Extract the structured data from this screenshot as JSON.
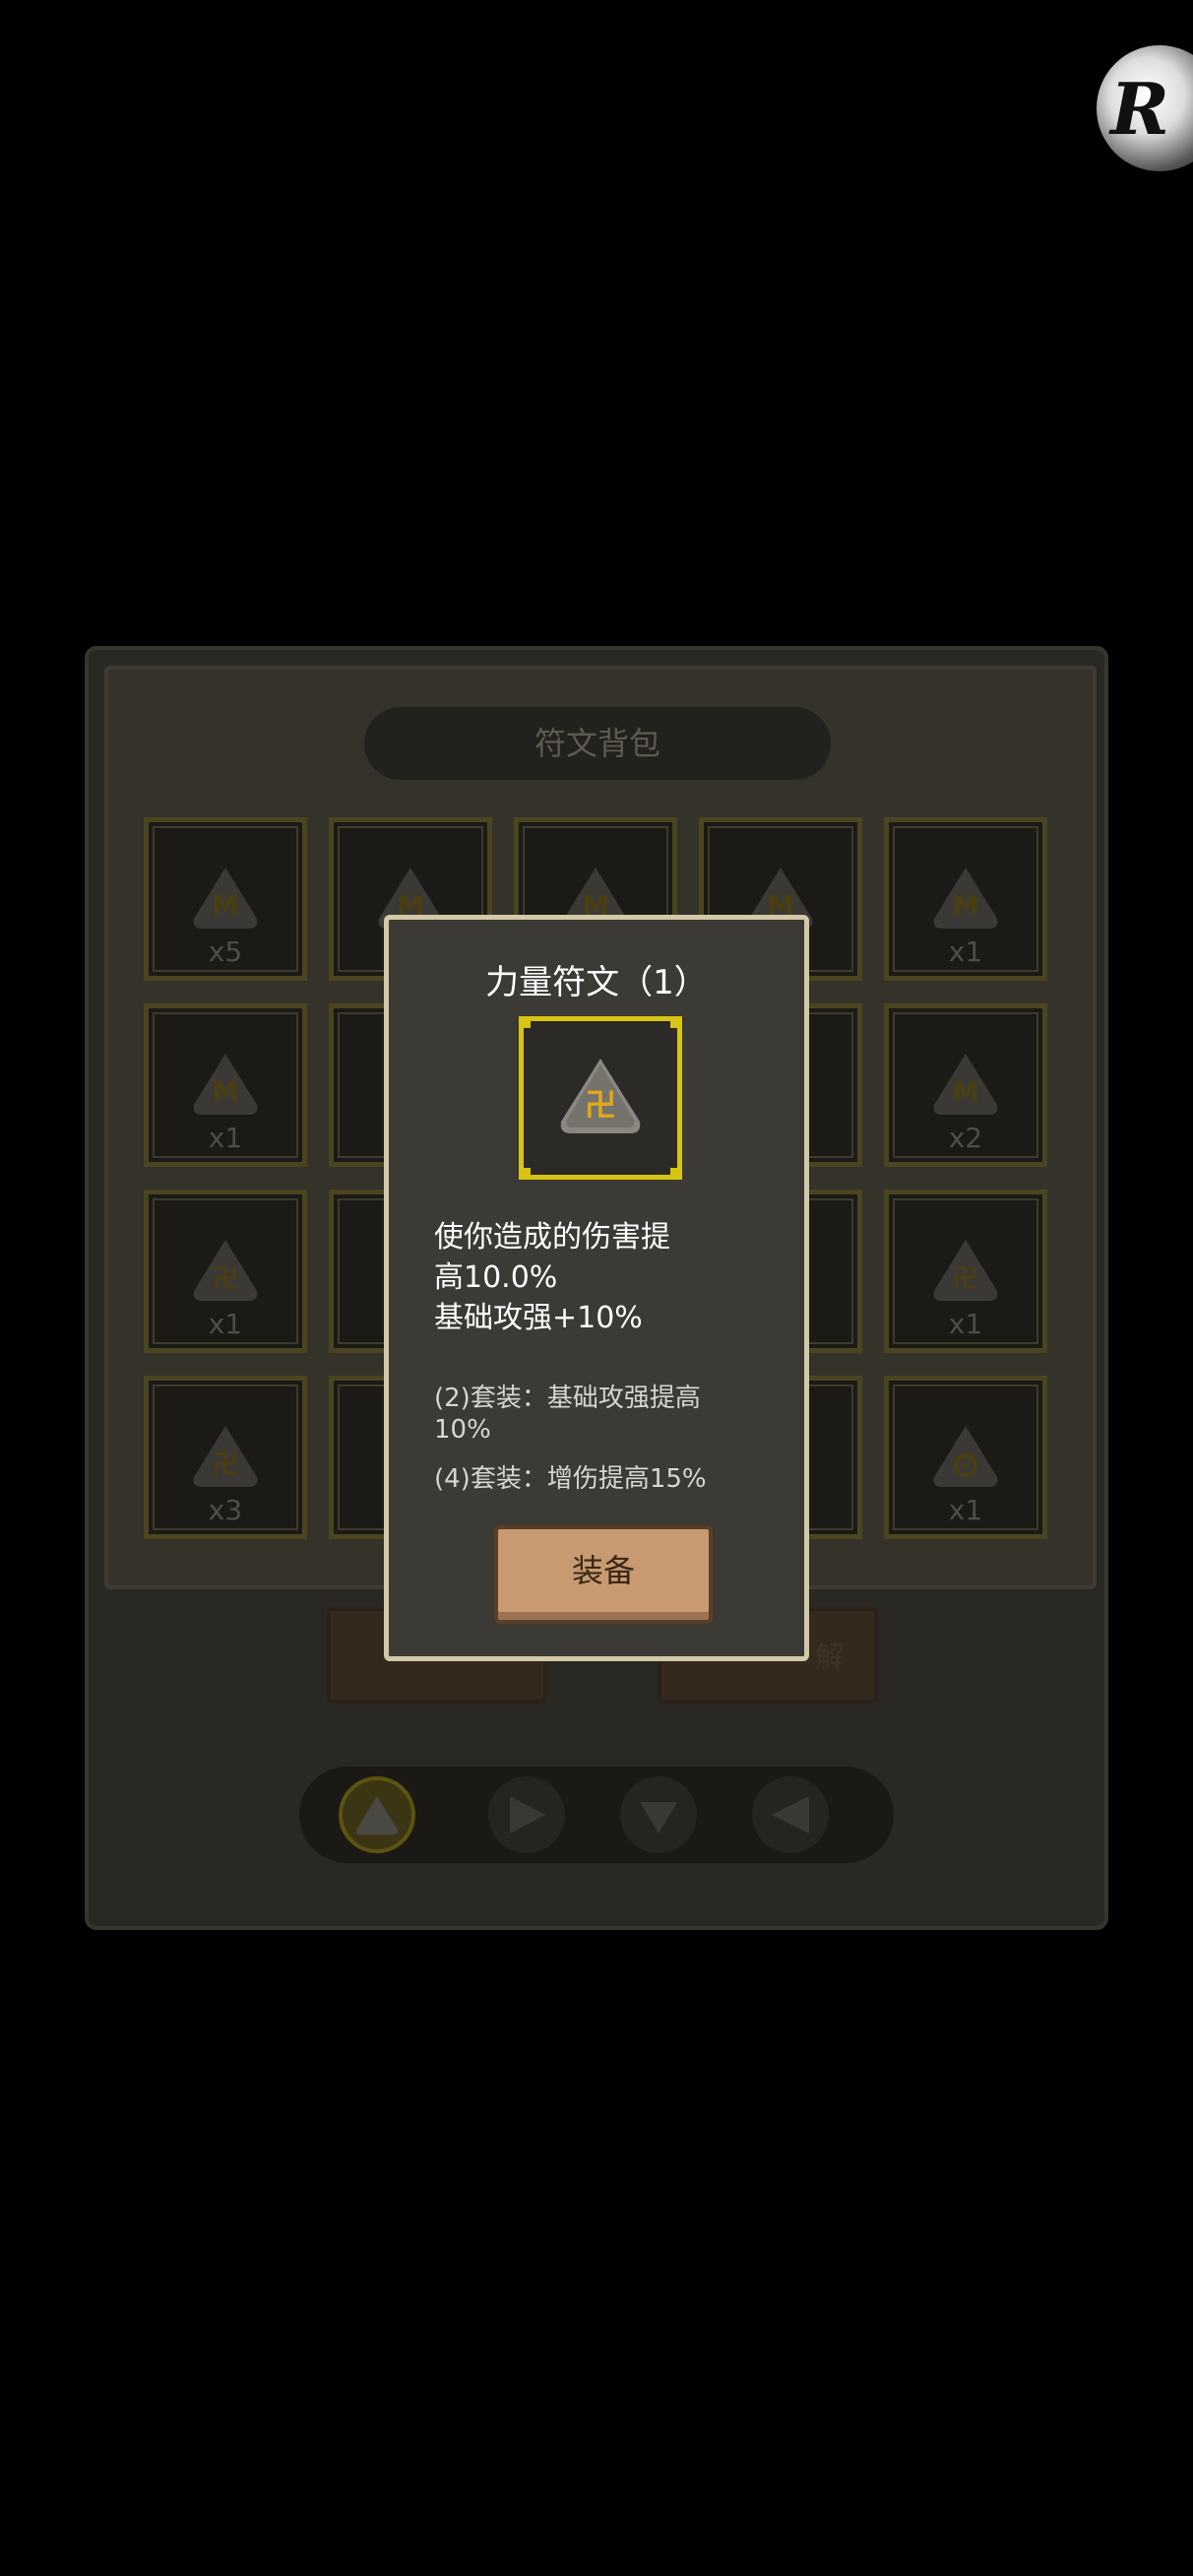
{
  "bag": {
    "title": "符文背包",
    "slots": [
      {
        "count": "x5",
        "glyph": "M"
      },
      {
        "count": "",
        "glyph": "M"
      },
      {
        "count": "",
        "glyph": "M"
      },
      {
        "count": "",
        "glyph": "M"
      },
      {
        "count": "x1",
        "glyph": "M"
      },
      {
        "count": "x1",
        "glyph": "M"
      },
      {
        "count": "x2",
        "glyph": "M"
      },
      {
        "count": "x1",
        "glyph": "卍"
      },
      {
        "count": "x1",
        "glyph": "卍"
      },
      {
        "count": "x3",
        "glyph": "卍"
      },
      {
        "count": "x1",
        "glyph": "O"
      }
    ],
    "side_button_right_label": "解"
  },
  "popup": {
    "title": "力量符文（1）",
    "desc_line1": "使你造成的伤害提",
    "desc_line2": "高10.0%",
    "desc_line3": "基础攻强+10%",
    "set2_line1": "(2)套装：基础攻强提高",
    "set2_line2": "10%",
    "set4": "(4)套装：增伤提高15%",
    "equip_label": "装备"
  },
  "tabs": [
    {
      "name": "shape-triangle",
      "selected": true
    },
    {
      "name": "shape-right",
      "selected": false
    },
    {
      "name": "shape-diamond",
      "selected": false
    },
    {
      "name": "shape-left",
      "selected": false
    }
  ],
  "colors": {
    "accent": "#d7c414",
    "rune": "#c79a18",
    "button": "#c79a72"
  }
}
